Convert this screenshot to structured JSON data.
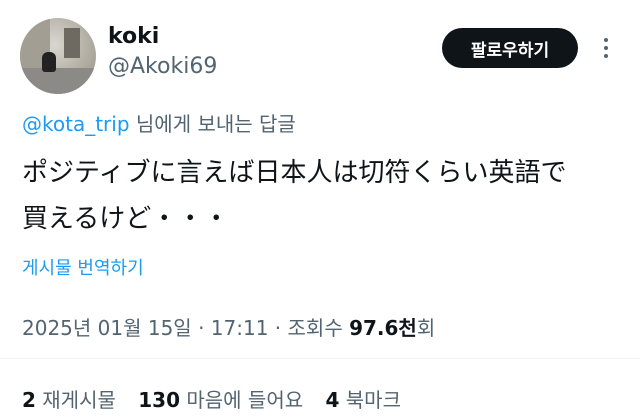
{
  "author": {
    "name": "koki",
    "handle": "@Akoki69"
  },
  "follow_button": "팔로우하기",
  "reply": {
    "mention": "@kota_trip",
    "suffix": " 님에게 보내는 답글"
  },
  "tweet": {
    "line1": "ポジティブに言えば日本人は切符くらい英語で",
    "line2": "買えるけど・・・"
  },
  "translate_link": "게시물 번역하기",
  "meta": {
    "date": "2025년 01월 15일",
    "sep1": " · ",
    "time": "17:11",
    "sep2": " · ",
    "views_label": "조회수 ",
    "views_count": "97.6천",
    "views_suffix": "회"
  },
  "stats": [
    {
      "count": "2",
      "label": "재게시물"
    },
    {
      "count": "130",
      "label": "마음에 들어요"
    },
    {
      "count": "4",
      "label": "북마크"
    }
  ],
  "icons": {
    "more": "more-dots-icon",
    "avatar": "avatar-photo"
  },
  "colors": {
    "accent": "#1d9bf0",
    "text": "#0f1419",
    "secondary": "#536471",
    "button_bg": "#0f1419"
  }
}
